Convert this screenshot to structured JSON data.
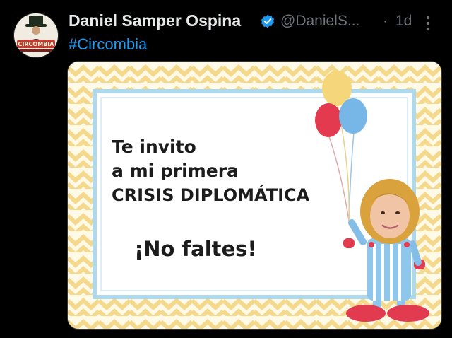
{
  "tweet": {
    "author_name": "Daniel Samper Ospina",
    "handle": "@DanielS...",
    "separator": "·",
    "time": "1d",
    "hashtag": "#Circombia",
    "avatar_text": "CIRCOMBIA"
  },
  "media": {
    "line1": "Te invito",
    "line2": "a mi primera",
    "line3": "CRISIS DIPLOMÁTICA",
    "line4": "¡No faltes!"
  },
  "colors": {
    "background": "#000000",
    "name": "#e7e9ea",
    "secondary": "#71767b",
    "link": "#1d9bf0",
    "verified": "#1d9bf0",
    "chevron": "#f3d889",
    "frame": "#aed9ec",
    "balloon_red": "#e33a4f",
    "balloon_blue": "#76b7e8",
    "balloon_yellow": "#f6d67a"
  }
}
